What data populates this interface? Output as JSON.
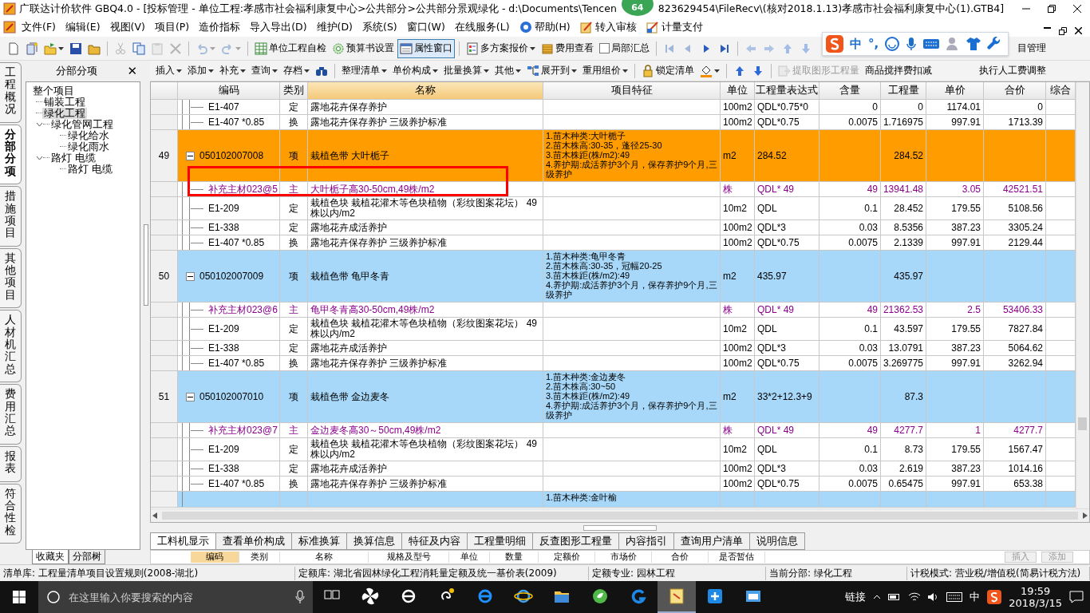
{
  "window": {
    "title_start": "广联达计价软件 GBQ4.0 - [投标管理 - 单位工程:孝感市社会福利康复中心>公共部分>公共部分景观绿化 - d:\\Documents\\Tencen",
    "badge": "64",
    "title_end": "823629454\\FileRecv\\(核对2018.1.13)孝感市社会福利康复中心(1).GTB4]"
  },
  "menu": [
    "文件(F)",
    "编辑(E)",
    "视图(V)",
    "项目(P)",
    "造价指标",
    "导入导出(D)",
    "维护(D)",
    "系统(S)",
    "窗口(W)",
    "在线服务(L)",
    "帮助(H)",
    "转入审核",
    "计量支付"
  ],
  "toolbar": [
    {
      "kind": "icon",
      "dropdown": false,
      "disabled": false,
      "pressed": false
    },
    {
      "kind": "icon",
      "dropdown": false,
      "disabled": false,
      "pressed": false
    },
    {
      "kind": "icon",
      "dropdown": true,
      "disabled": false,
      "pressed": false
    },
    {
      "kind": "icon",
      "dropdown": false,
      "disabled": false,
      "pressed": false
    },
    {
      "kind": "icon",
      "dropdown": false,
      "disabled": false,
      "pressed": false
    },
    {
      "kind": "sep"
    },
    {
      "kind": "icon",
      "dropdown": false,
      "disabled": true,
      "pressed": false
    },
    {
      "kind": "icon",
      "dropdown": false,
      "disabled": false,
      "pressed": false
    },
    {
      "kind": "icon",
      "dropdown": false,
      "disabled": true,
      "pressed": false
    },
    {
      "kind": "icon",
      "dropdown": false,
      "disabled": true,
      "pressed": false
    },
    {
      "kind": "sep"
    },
    {
      "kind": "icon",
      "dropdown": true,
      "disabled": true,
      "pressed": false
    },
    {
      "kind": "icon",
      "dropdown": true,
      "disabled": true,
      "pressed": false
    },
    {
      "kind": "sep"
    },
    {
      "kind": "labeled",
      "label": "单位工程自检",
      "dropdown": false,
      "disabled": false,
      "pressed": false
    },
    {
      "kind": "labeled",
      "label": "预算书设置",
      "dropdown": false,
      "disabled": false,
      "pressed": false
    },
    {
      "kind": "labeled",
      "label": "属性窗口",
      "dropdown": false,
      "disabled": false,
      "pressed": true
    },
    {
      "kind": "sep"
    },
    {
      "kind": "labeled",
      "label": "多方案报价",
      "dropdown": true,
      "disabled": false,
      "pressed": false
    },
    {
      "kind": "labeled",
      "label": "费用查看",
      "dropdown": false,
      "disabled": false,
      "pressed": false
    },
    {
      "kind": "check",
      "label": "局部汇总",
      "checked": false,
      "disabled": false,
      "pressed": false
    },
    {
      "kind": "sep"
    },
    {
      "kind": "icon",
      "dropdown": false,
      "disabled": true,
      "pressed": false
    },
    {
      "kind": "icon",
      "dropdown": false,
      "disabled": true,
      "pressed": false
    },
    {
      "kind": "icon",
      "dropdown": false,
      "disabled": false,
      "pressed": false
    },
    {
      "kind": "icon",
      "dropdown": false,
      "disabled": false,
      "pressed": false
    },
    {
      "kind": "sep"
    },
    {
      "kind": "icon",
      "dropdown": false,
      "disabled": true,
      "pressed": false
    },
    {
      "kind": "icon",
      "dropdown": false,
      "disabled": true,
      "pressed": false
    },
    {
      "kind": "icon",
      "dropdown": false,
      "disabled": true,
      "pressed": false
    },
    {
      "kind": "icon",
      "dropdown": false,
      "disabled": true,
      "pressed": false
    },
    {
      "kind": "text",
      "label": "目管理",
      "dropdown": false,
      "disabled": false,
      "pressed": false
    }
  ],
  "ime": {
    "language": "中",
    "punctuation": "°,"
  },
  "side_tabs": [
    {
      "label": "工程概况",
      "selected": false
    },
    {
      "label": "分部分项",
      "selected": true
    },
    {
      "label": "措施项目",
      "selected": false
    },
    {
      "label": "其他项目",
      "selected": false
    },
    {
      "label": "人材机汇总",
      "selected": false
    },
    {
      "label": "费用汇总",
      "selected": false
    },
    {
      "label": "报表",
      "selected": false
    },
    {
      "label": "符合性检",
      "selected": false
    }
  ],
  "panel": {
    "title": "分部分项",
    "close": "✕"
  },
  "tree": [
    {
      "label": "整个项目",
      "selected": false,
      "children": [
        {
          "label": "铺装工程",
          "selected": false
        },
        {
          "label": "绿化工程",
          "selected": true
        },
        {
          "label": "绿化管网工程",
          "selected": false,
          "expanded": true,
          "children": [
            {
              "label": "绿化给水",
              "selected": false
            },
            {
              "label": "绿化雨水",
              "selected": false
            }
          ]
        },
        {
          "label": "路灯 电缆",
          "selected": false,
          "expanded": true,
          "children": [
            {
              "label": "路灯 电缆",
              "selected": false
            }
          ]
        }
      ]
    }
  ],
  "panel_tabs": [
    {
      "label": "收藏夹",
      "selected": true
    },
    {
      "label": "分部树",
      "selected": false
    }
  ],
  "toolbar2": [
    {
      "kind": "text",
      "label": "插入",
      "dropdown": true,
      "disabled": false
    },
    {
      "kind": "text",
      "label": "添加",
      "dropdown": true,
      "disabled": false
    },
    {
      "kind": "text",
      "label": "补充",
      "dropdown": true,
      "disabled": false
    },
    {
      "kind": "text",
      "label": "查询",
      "dropdown": true,
      "disabled": false
    },
    {
      "kind": "text",
      "label": "存档",
      "dropdown": true,
      "disabled": false
    },
    {
      "kind": "icon",
      "dropdown": false,
      "disabled": false
    },
    {
      "kind": "sep"
    },
    {
      "kind": "text",
      "label": "整理清单",
      "dropdown": true,
      "disabled": false
    },
    {
      "kind": "text",
      "label": "单价构成",
      "dropdown": true,
      "disabled": false
    },
    {
      "kind": "text",
      "label": "批量换算",
      "dropdown": true,
      "disabled": false
    },
    {
      "kind": "text",
      "label": "其他",
      "dropdown": true,
      "disabled": false
    },
    {
      "kind": "labeled",
      "label": "展开到",
      "dropdown": true,
      "disabled": false
    },
    {
      "kind": "text",
      "label": "重用组价",
      "dropdown": true,
      "disabled": false
    },
    {
      "kind": "sep"
    },
    {
      "kind": "labeled",
      "label": "锁定清单",
      "dropdown": false,
      "disabled": false
    },
    {
      "kind": "icon",
      "dropdown": true,
      "disabled": false
    },
    {
      "kind": "sep"
    },
    {
      "kind": "icon",
      "dropdown": false,
      "disabled": false
    },
    {
      "kind": "icon",
      "dropdown": false,
      "disabled": false
    },
    {
      "kind": "sep"
    },
    {
      "kind": "labeled",
      "label": "提取图形工程量",
      "dropdown": false,
      "disabled": true
    },
    {
      "kind": "text",
      "label": "商品搅拌费扣减",
      "dropdown": false,
      "disabled": false
    },
    {
      "kind": "text",
      "label": "执行人工费调整",
      "dropdown": false,
      "disabled": false
    }
  ],
  "table": {
    "columns": [
      {
        "label": "编码",
        "selected": false
      },
      {
        "label": "类别",
        "selected": false
      },
      {
        "label": "名称",
        "selected": true
      },
      {
        "label": "项目特征",
        "selected": false
      },
      {
        "label": "单位",
        "selected": false
      },
      {
        "label": "工程量表达式",
        "selected": false
      },
      {
        "label": "含量",
        "selected": false
      },
      {
        "label": "工程量",
        "selected": false
      },
      {
        "label": "单价",
        "selected": false
      },
      {
        "label": "合价",
        "selected": false
      },
      {
        "label": "综合",
        "selected": false
      }
    ],
    "highlight_box": true,
    "rows": [
      {
        "kind": "quota",
        "code": "E1-407",
        "type": "定",
        "name": "露地花卉保存养护",
        "unit": "100m2",
        "expr": "QDL*0.75*0",
        "content": "0",
        "qty": "0",
        "price": "1174.01",
        "total": "0"
      },
      {
        "kind": "quota",
        "code": "E1-407 *0.85",
        "type": "换",
        "name": "露地花卉保存养护 三级养护标准",
        "unit": "100m2",
        "expr": "QDL*0.75",
        "content": "0.0075",
        "qty": "1.716975",
        "price": "997.91",
        "total": "1713.39"
      },
      {
        "kind": "item",
        "no": "49",
        "code": "050102007008",
        "type": "项",
        "name": "栽植色带 大叶栀子",
        "features": "1.苗木种类:大叶栀子\n2.苗木株高:30-35，蓬径25-30\n3.苗木株距(株/m2):49\n4.养护期:成活养护3个月，保存养护9个月,三级养护",
        "unit": "m2",
        "expr": "284.52",
        "qty": "284.52",
        "selected": true,
        "expanded": true
      },
      {
        "kind": "main",
        "code": "补充主材023@5",
        "type": "主",
        "name": "大叶栀子高30-50cm,49株/m2",
        "unit": "株",
        "expr": "QDL* 49",
        "content": "49",
        "qty": "13941.48",
        "price": "3.05",
        "total": "42521.51"
      },
      {
        "kind": "quota",
        "code": "E1-209",
        "type": "定",
        "name": "栽植色块 栽植花灌木等色块植物（彩纹图案花坛） 49株以内/m2",
        "unit": "10m2",
        "expr": "QDL",
        "content": "0.1",
        "qty": "28.452",
        "price": "179.55",
        "total": "5108.56"
      },
      {
        "kind": "quota",
        "code": "E1-338",
        "type": "定",
        "name": "露地花卉成活养护",
        "unit": "100m2",
        "expr": "QDL*3",
        "content": "0.03",
        "qty": "8.5356",
        "price": "387.23",
        "total": "3305.24"
      },
      {
        "kind": "quota",
        "code": "E1-407 *0.85",
        "type": "换",
        "name": "露地花卉保存养护 三级养护标准",
        "unit": "100m2",
        "expr": "QDL*0.75",
        "content": "0.0075",
        "qty": "2.1339",
        "price": "997.91",
        "total": "2129.44"
      },
      {
        "kind": "item",
        "no": "50",
        "code": "050102007009",
        "type": "项",
        "name": "栽植色带 龟甲冬青",
        "features": "1.苗木种类:龟甲冬青\n2.苗木株高:30-35，冠幅20-25\n3.苗木株距(株/m2):49\n4.养护期:成活养护3个月，保存养护9个月,三级养护",
        "unit": "m2",
        "expr": "435.97",
        "qty": "435.97",
        "selected": false,
        "expanded": true
      },
      {
        "kind": "main",
        "code": "补充主材023@6",
        "type": "主",
        "name": "龟甲冬青高30-50cm,49株/m2",
        "unit": "株",
        "expr": "QDL* 49",
        "content": "49",
        "qty": "21362.53",
        "price": "2.5",
        "total": "53406.33"
      },
      {
        "kind": "quota",
        "code": "E1-209",
        "type": "定",
        "name": "栽植色块 栽植花灌木等色块植物（彩纹图案花坛） 49株以内/m2",
        "unit": "10m2",
        "expr": "QDL",
        "content": "0.1",
        "qty": "43.597",
        "price": "179.55",
        "total": "7827.84"
      },
      {
        "kind": "quota",
        "code": "E1-338",
        "type": "定",
        "name": "露地花卉成活养护",
        "unit": "100m2",
        "expr": "QDL*3",
        "content": "0.03",
        "qty": "13.0791",
        "price": "387.23",
        "total": "5064.62"
      },
      {
        "kind": "quota",
        "code": "E1-407 *0.85",
        "type": "换",
        "name": "露地花卉保存养护 三级养护标准",
        "unit": "100m2",
        "expr": "QDL*0.75",
        "content": "0.0075",
        "qty": "3.269775",
        "price": "997.91",
        "total": "3262.94"
      },
      {
        "kind": "item",
        "no": "51",
        "code": "050102007010",
        "type": "项",
        "name": "栽植色带 金边麦冬",
        "features": "1.苗木种类:金边麦冬\n2.苗木株高:30~50\n3.苗木株距(株/m2):49\n4.养护期:成活养护3个月，保存养护9个月,三级养护",
        "unit": "m2",
        "expr": "33*2+12.3+9",
        "qty": "87.3",
        "selected": false,
        "expanded": true
      },
      {
        "kind": "main",
        "code": "补充主材023@7",
        "type": "主",
        "name": "金边麦冬高30～50cm,49株/m2",
        "unit": "株",
        "expr": "QDL* 49",
        "content": "49",
        "qty": "4277.7",
        "price": "1",
        "total": "4277.7"
      },
      {
        "kind": "quota",
        "code": "E1-209",
        "type": "定",
        "name": "栽植色块 栽植花灌木等色块植物（彩纹图案花坛） 49株以内/m2",
        "unit": "10m2",
        "expr": "QDL",
        "content": "0.1",
        "qty": "8.73",
        "price": "179.55",
        "total": "1567.47"
      },
      {
        "kind": "quota",
        "code": "E1-338",
        "type": "定",
        "name": "露地花卉成活养护",
        "unit": "100m2",
        "expr": "QDL*3",
        "content": "0.03",
        "qty": "2.619",
        "price": "387.23",
        "total": "1014.16"
      },
      {
        "kind": "quota",
        "code": "E1-407 *0.85",
        "type": "换",
        "name": "露地花卉保存养护 三级养护标准",
        "unit": "100m2",
        "expr": "QDL*0.75",
        "content": "0.0075",
        "qty": "0.65475",
        "price": "997.91",
        "total": "653.38"
      },
      {
        "kind": "partial",
        "features": "1.苗木种类:金叶榆",
        "selected": false
      }
    ]
  },
  "detail_tabs": [
    {
      "label": "工料机显示",
      "selected": true
    },
    {
      "label": "查看单价构成",
      "selected": false
    },
    {
      "label": "标准换算",
      "selected": false
    },
    {
      "label": "换算信息",
      "selected": false
    },
    {
      "label": "特征及内容",
      "selected": false
    },
    {
      "label": "工程量明细",
      "selected": false
    },
    {
      "label": "反查图形工程量",
      "selected": false
    },
    {
      "label": "内容指引",
      "selected": false
    },
    {
      "label": "查询用户清单",
      "selected": false
    },
    {
      "label": "说明信息",
      "selected": false
    }
  ],
  "detail_columns": [
    {
      "label": "编码",
      "selected": true
    },
    {
      "label": "类别",
      "selected": false
    },
    {
      "label": "名称",
      "selected": false
    },
    {
      "label": "规格及型号",
      "selected": false
    },
    {
      "label": "单位",
      "selected": false
    },
    {
      "label": "数量",
      "selected": false
    },
    {
      "label": "定额价",
      "selected": false
    },
    {
      "label": "市场价",
      "selected": false
    },
    {
      "label": "合价",
      "selected": false
    },
    {
      "label": "是否暂估",
      "selected": false
    }
  ],
  "detail_buttons": [
    "插入",
    "添加"
  ],
  "status_bar": [
    "清单库: 工程量清单项目设置规则(2008-湖北)",
    "定额库: 湖北省园林绿化工程消耗量定额及统一基价表(2009)",
    "定额专业: 园林工程",
    "当前分部: 绿化工程",
    "计税模式: 营业税/增值税(简易计税方法)"
  ],
  "taskbar": {
    "search": {
      "placeholder": "在这里输入你要搜索的内容"
    },
    "apps": [
      {
        "selected": false
      },
      {
        "selected": false
      },
      {
        "selected": false
      },
      {
        "selected": false
      },
      {
        "selected": false
      },
      {
        "selected": false
      },
      {
        "selected": false
      },
      {
        "selected": false
      },
      {
        "selected": false
      },
      {
        "selected": true
      },
      {
        "selected": false
      },
      {
        "selected": false
      }
    ],
    "link": "链接",
    "language": "中",
    "time": "19:59",
    "date": "2018/3/15"
  }
}
